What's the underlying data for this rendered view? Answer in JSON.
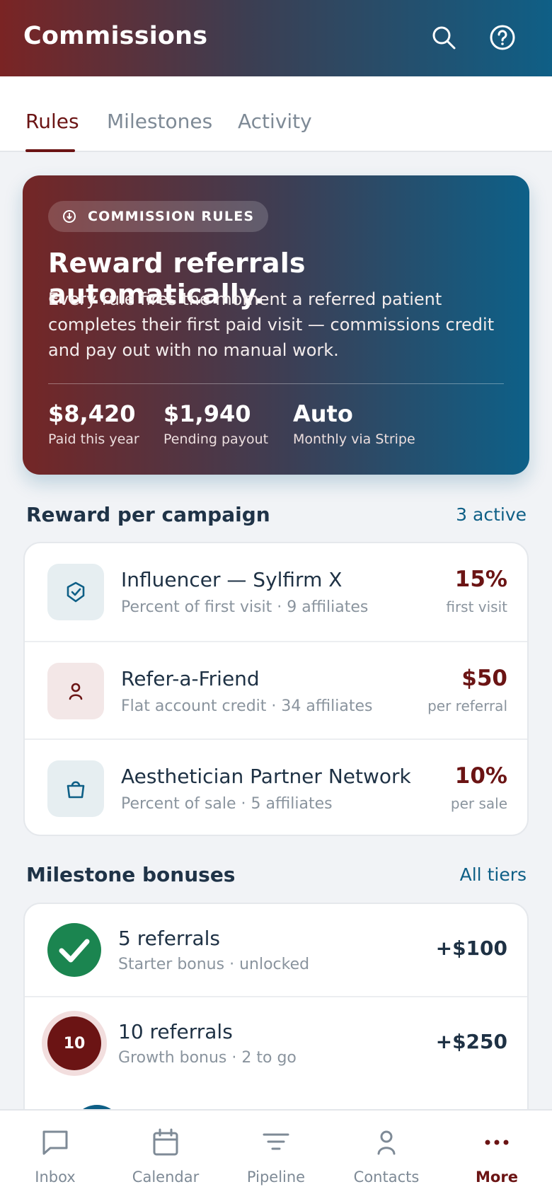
{
  "appbar": {
    "title": "Commissions",
    "search_icon": "search-icon",
    "help_icon": "help-icon"
  },
  "tabs": [
    {
      "label": "Rules",
      "active": true
    },
    {
      "label": "Milestones",
      "active": false
    },
    {
      "label": "Activity",
      "active": false
    }
  ],
  "hero": {
    "badge": "COMMISSION RULES",
    "headline": "Reward referrals automatically.",
    "description": "Every rule fires the moment a referred patient completes their first paid visit — commissions credit and pay out with no manual work.",
    "stats": [
      {
        "value": "$8,420",
        "label": "Paid this year"
      },
      {
        "value": "$1,940",
        "label": "Pending payout"
      },
      {
        "value": "Auto",
        "label": "Monthly via Stripe"
      }
    ]
  },
  "campaigns_section": {
    "title": "Reward per campaign",
    "link": "3 active"
  },
  "campaigns": [
    {
      "name": "Influencer — Sylfirm X",
      "sub": "Percent of first visit · 9 affiliates",
      "amount": "15%",
      "unit": "first visit",
      "icon": "shield-check-icon"
    },
    {
      "name": "Refer-a-Friend",
      "sub": "Flat account credit · 34 affiliates",
      "amount": "$50",
      "unit": "per referral",
      "icon": "person-icon"
    },
    {
      "name": "Aesthetician Partner Network",
      "sub": "Percent of sale · 5 affiliates",
      "amount": "10%",
      "unit": "per sale",
      "icon": "shopping-bag-icon"
    }
  ],
  "milestones_section": {
    "title": "Milestone bonuses",
    "link": "All tiers"
  },
  "milestones": [
    {
      "name": "5 referrals",
      "sub": "Starter bonus · unlocked",
      "amount": "+$100",
      "badge": "",
      "state": "unlocked"
    },
    {
      "name": "10 referrals",
      "sub": "Growth bonus · 2 to go",
      "amount": "+$250",
      "badge": "10",
      "state": "in-progress"
    }
  ],
  "bottom_nav": [
    {
      "label": "Inbox",
      "icon": "chat-bubble-icon"
    },
    {
      "label": "Calendar",
      "icon": "calendar-icon"
    },
    {
      "label": "Pipeline",
      "icon": "filter-lines-icon"
    },
    {
      "label": "Contacts",
      "icon": "person-icon"
    },
    {
      "label": "More",
      "icon": "more-dots-icon",
      "active": true
    }
  ],
  "colors": {
    "brand_red": "#6b1414",
    "brand_blue": "#0e5f86",
    "success_green": "#1b8550"
  }
}
